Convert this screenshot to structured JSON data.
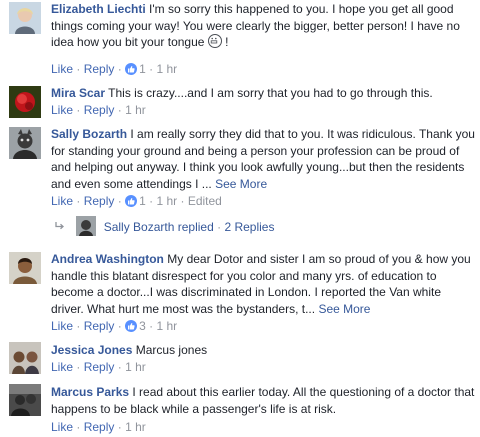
{
  "comments": [
    {
      "author": "Elizabeth Liechti",
      "text": "I'm so sorry this happened to you. I hope you get all good things coming your way! You were clearly the bigger, better person! I have no idea how you bit your tongue ",
      "text_end": " !",
      "emoji": "grimacing-face",
      "like": "Like",
      "reply": "Reply",
      "likes": "1",
      "time": "1 hr",
      "edited": ""
    },
    {
      "author": "Mira Scar",
      "text": "This is crazy....and I am sorry that you had to go through this.",
      "like": "Like",
      "reply": "Reply",
      "time": "1 hr"
    },
    {
      "author": "Sally Bozarth",
      "text": "I am really sorry they did that to you. It was ridiculous. Thank you for standing your ground and being a person your profession can be proud of and helping out anyway. I think you look awfully young...but then the residents and even some attendings I ... ",
      "see_more": "See More",
      "like": "Like",
      "reply": "Reply",
      "likes": "1",
      "time": "1 hr",
      "edited": "Edited",
      "replies_summary": {
        "who": "Sally Bozarth replied",
        "count": "2 Replies"
      }
    },
    {
      "author": "Andrea Washington",
      "text": "My dear Dotor and sister I am so proud of you & how you handle this blatant disrespect for you color and many yrs. of education to become a doctor...I was discriminated in London. I reported the Van white driver. What hurt me most was the bystanders, t... ",
      "see_more": "See More",
      "like": "Like",
      "reply": "Reply",
      "likes": "3",
      "time": "1 hr"
    },
    {
      "author": "Jessica Jones",
      "text": "Marcus jones",
      "like": "Like",
      "reply": "Reply",
      "time": "1 hr"
    },
    {
      "author": "Marcus Parks",
      "text": "I read about this earlier today. All the questioning of a doctor that happens to be black while a passenger's life is at risk.",
      "like": "Like",
      "reply": "Reply",
      "time": "1 hr"
    }
  ],
  "colors": {
    "author": "#365899",
    "link": "#4267b2",
    "meta": "#90949c",
    "like_badge": "#5890ff"
  }
}
